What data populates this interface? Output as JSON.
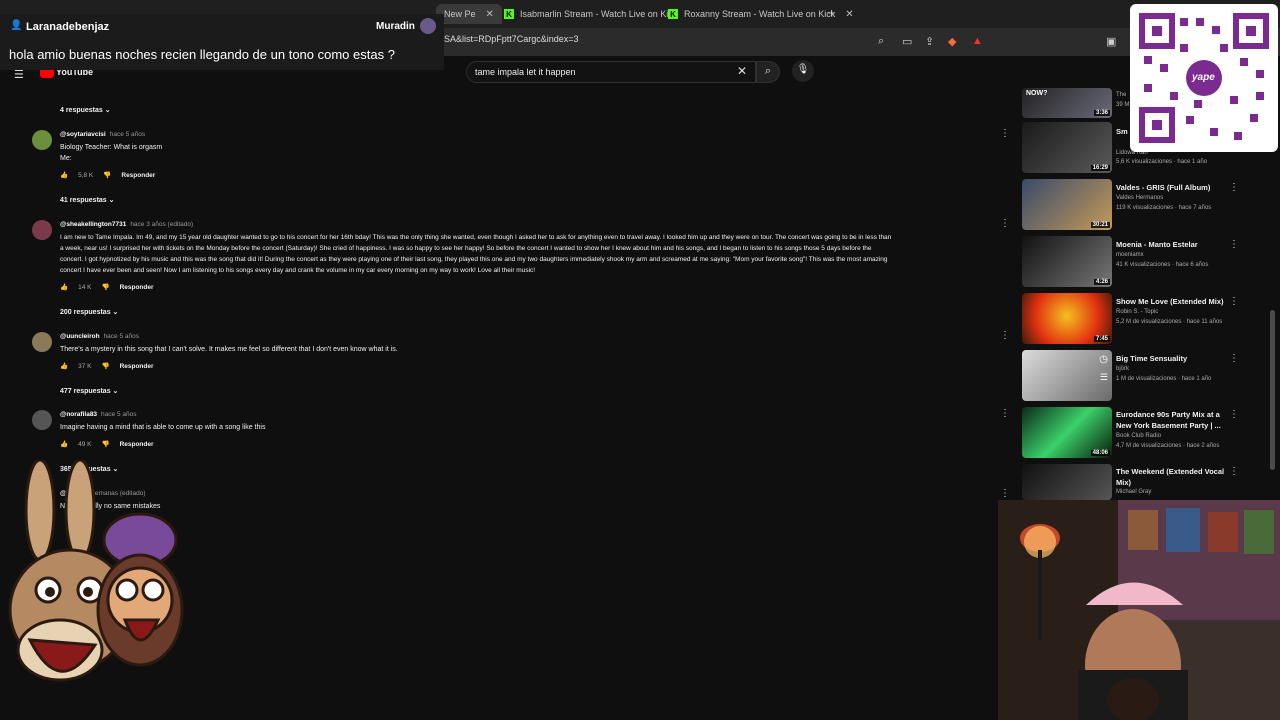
{
  "browser": {
    "tabs": [
      {
        "label": "New Pe",
        "active": true
      },
      {
        "label": "Isabmarlin Stream - Watch Live on Ki"
      },
      {
        "label": "Roxanny Stream - Watch Live on Kick"
      }
    ],
    "new_tab": "+",
    "url": "SA&list=RDpFptt7Cargc&index=3"
  },
  "chat_overlay": {
    "username": "Laranadebenjaz",
    "right_user": "Muradin",
    "message": "hola amio buenas noches recien llegando de un tono como estas ?"
  },
  "youtube": {
    "logo": "YouTube",
    "search_value": "tame impala let it happen"
  },
  "comments": {
    "top_replies": "4 respuestas",
    "items": [
      {
        "user": "@soytariavcisi",
        "time": "hace 5 años",
        "text_lines": [
          "Biology Teacher: What is orgasm",
          "Me:"
        ],
        "likes": "5,8 K",
        "reply": "Responder",
        "replies": "41 respuestas"
      },
      {
        "user": "@sheakellington7731",
        "time": "hace 3 años (editado)",
        "text_lines": [
          "I am new to Tame Impala. Im 49, and my 15 year old daughter wanted to go to his concert for her 16th bday! This was the only thing she wanted, even though I asked her to ask for anything even to travel away. I looked him up and they were on tour. The concert was going to be in less than",
          "a week, near us!  I surprised her with tickets on the Monday before the concert (Saturday)! She cried of happiness. I was so happy to see her happy! So before the concert I wanted to show her I knew about him and his songs, and I began to listen to his songs those 5 days before the",
          "concert. I got hypnotized by his music and this was the song that did it! During the concert as they were playing one of their last song, they played this one and my two daughters immediately shook my arm and screamed at me saying: \"Mom your favorite song\"! This was the most amazing",
          "concert I have ever been and seen! Now I am listening to his songs every day and crank the volume in my car every morning on my way to work! Love all their music!"
        ],
        "likes": "14 K",
        "reply": "Responder",
        "replies": "200 respuestas"
      },
      {
        "user": "@uuncleiroh",
        "time": "hace 5 años",
        "text_lines": [
          "There's a mystery in this song that I can't solve. It makes me feel so different that I don't even know what it is."
        ],
        "likes": "37 K",
        "reply": "Responder",
        "replies": "477 respuestas"
      },
      {
        "user": "@norafila83",
        "time": "hace 5 años",
        "text_lines": [
          "Imagine having a mind that is able to come up with a song like this"
        ],
        "likes": "49 K",
        "reply": "Responder",
        "replies": "365 respuestas"
      },
      {
        "user": "@",
        "time": "hace 2 semanas (editado)",
        "text_lines": [
          "N      new      pefully no same mistakes"
        ],
        "likes": "",
        "reply": "",
        "replies": ""
      }
    ]
  },
  "sidebar": {
    "now_label": "NOW?",
    "videos": [
      {
        "title": "",
        "channel": "The",
        "meta": "39 M",
        "duration": "3:36"
      },
      {
        "title": "Sm Ext",
        "channel": "Lidowa Ran",
        "meta": "5,6 K visualizaciones · hace 1 año",
        "duration": "16:29"
      },
      {
        "title": "Valdes - GRIS (Full Album)",
        "channel": "Valdes Hermanos",
        "meta": "119 K visualizaciones · hace 7 años",
        "duration": "30:21"
      },
      {
        "title": "Moenia - Manto Estelar",
        "channel": "moeniamx",
        "meta": "41 K visualizaciones · hace 6 años",
        "duration": "4:26"
      },
      {
        "title": "Show Me Love (Extended Mix)",
        "channel": "Robin S. - Topic",
        "meta": "5,2 M de visualizaciones · hace 11 años",
        "duration": "7:45"
      },
      {
        "title": "Big Time Sensuality",
        "channel": "björk",
        "meta": "1 M de visualizaciones · hace 1 año",
        "duration": ""
      },
      {
        "title": "Eurodance 90s Party Mix at a New York Basement Party | ...",
        "channel": "Book Club Radio",
        "meta": "4,7 M de visualizaciones · hace 2 años",
        "duration": "48:06"
      },
      {
        "title": "The Weekend (Extended Vocal Mix)",
        "channel": "Michael Gray",
        "meta": "",
        "duration": ""
      }
    ]
  },
  "qr_overlay": {
    "brand": "yape",
    "accent": "#7b2a8f"
  },
  "colors": {
    "page_bg": "#0f0f0f",
    "kick_green": "#53fc18",
    "yt_red": "#ff0000"
  }
}
